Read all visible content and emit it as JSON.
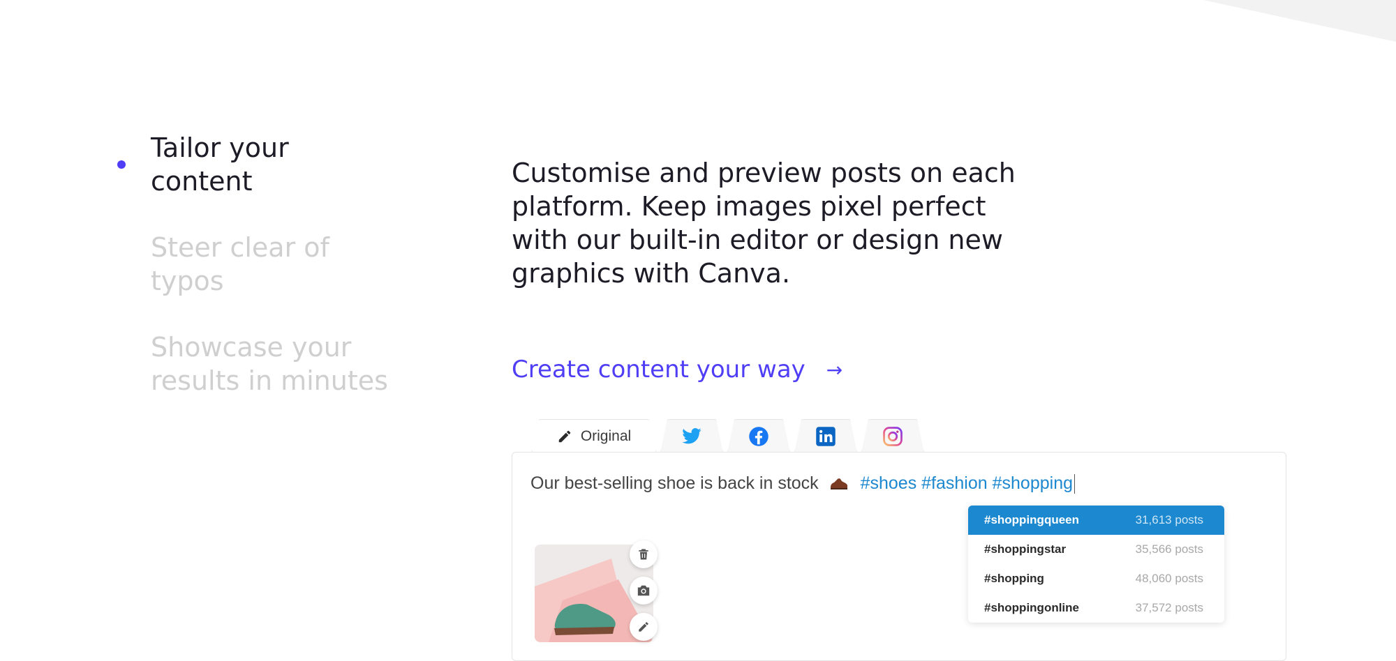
{
  "features": [
    {
      "label": "Tailor your content",
      "active": true
    },
    {
      "label": "Steer clear of typos",
      "active": false
    },
    {
      "label": "Showcase your results in minutes",
      "active": false
    }
  ],
  "description": "Customise and preview posts on each platform. Keep images pixel perfect with our built-in editor or design new graphics with Canva.",
  "cta": {
    "label": "Create content your way",
    "arrow": "→"
  },
  "editor": {
    "tabs": {
      "original": "Original",
      "social": [
        "twitter-icon",
        "facebook-icon",
        "linkedin-icon",
        "instagram-icon"
      ]
    },
    "post_text": "Our best-selling shoe is back in stock",
    "hashtags": "#shoes #fashion #shopping",
    "suggestions": [
      {
        "tag": "#shoppingqueen",
        "count": "31,613 posts",
        "selected": true
      },
      {
        "tag": "#shoppingstar",
        "count": "35,566 posts",
        "selected": false
      },
      {
        "tag": "#shopping",
        "count": "48,060 posts",
        "selected": false
      },
      {
        "tag": "#shoppingonline",
        "count": "37,572 posts",
        "selected": false
      }
    ]
  },
  "colors": {
    "accent": "#4f3ef5",
    "hashtag": "#1c88cf",
    "twitter": "#1da1f2",
    "facebook": "#1877f2",
    "linkedin": "#0a66c2"
  }
}
